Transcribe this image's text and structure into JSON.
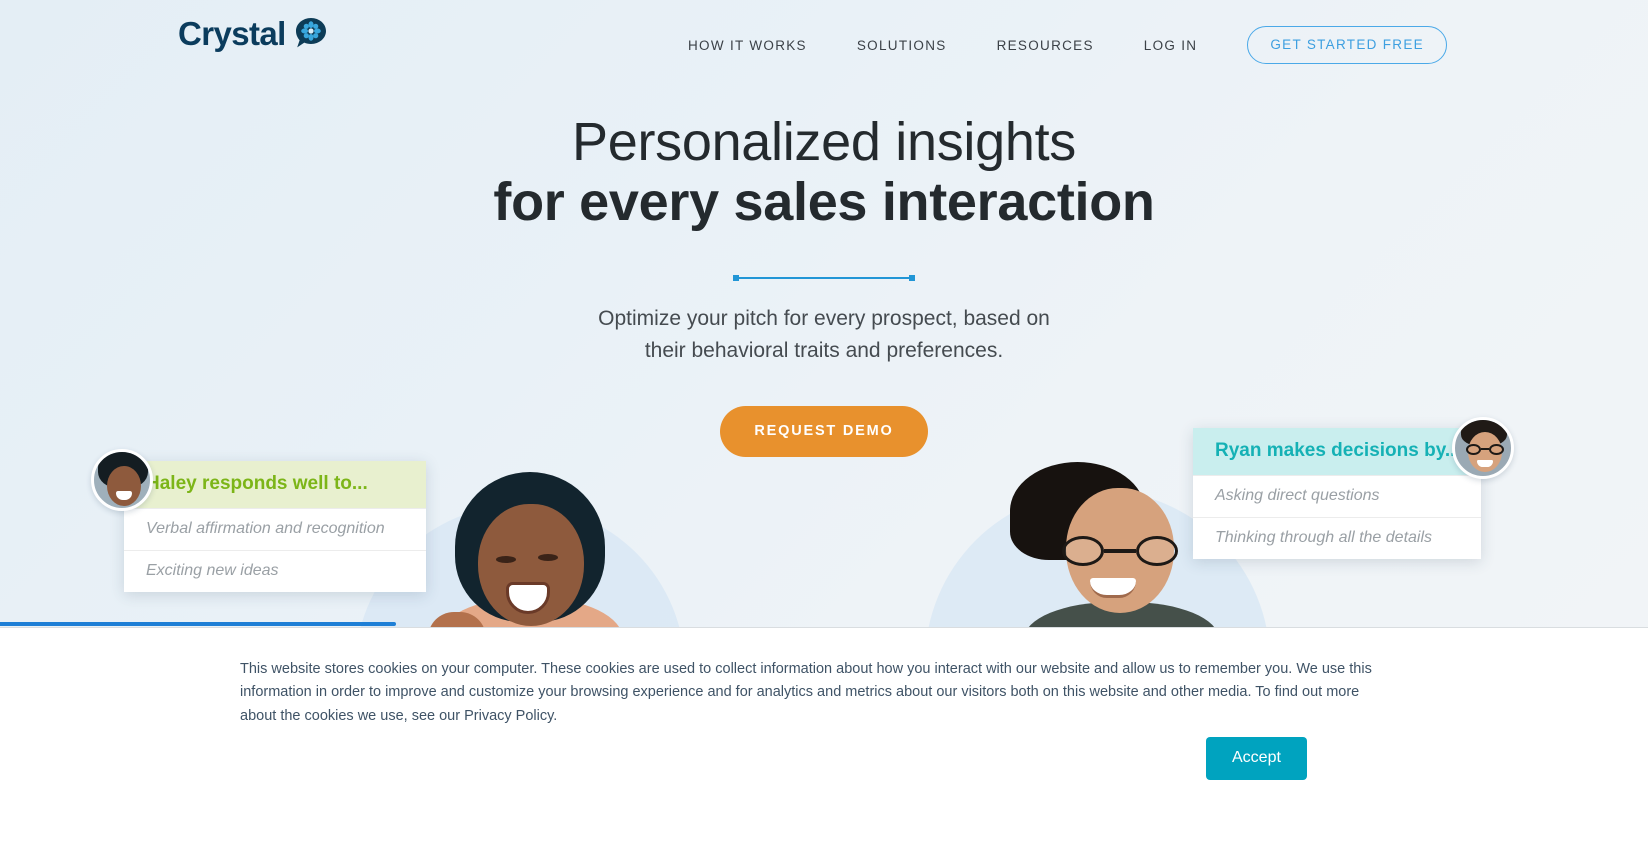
{
  "brand": {
    "name": "Crystal",
    "logo_icon": "crystal-flower-speech-bubble-icon",
    "logo_color": "#0b3c5d",
    "accent_blue": "#2196d6"
  },
  "nav": {
    "items": [
      {
        "label": "HOW IT WORKS"
      },
      {
        "label": "SOLUTIONS"
      },
      {
        "label": "RESOURCES"
      },
      {
        "label": "LOG IN"
      }
    ],
    "cta": {
      "label": "GET STARTED FREE",
      "color": "#3d9fe0"
    }
  },
  "hero": {
    "headline_line1": "Personalized insights",
    "headline_line2": "for every sales interaction",
    "subhead_line1": "Optimize your pitch for every prospect, based on",
    "subhead_line2": "their behavioral traits and preferences.",
    "cta": {
      "label": "REQUEST DEMO",
      "color": "#e8912d"
    }
  },
  "cards": {
    "left": {
      "title": "Haley responds well to...",
      "title_color": "#7cb518",
      "header_bg": "#e8f0cf",
      "avatar": "haley-avatar",
      "rows": [
        "Verbal affirmation and recognition",
        "Exciting new ideas"
      ]
    },
    "right": {
      "title": "Ryan makes decisions by...",
      "title_color": "#15b1b5",
      "header_bg": "#c9eeee",
      "avatar": "ryan-avatar",
      "rows": [
        "Asking direct questions",
        "Thinking through all the details"
      ]
    }
  },
  "progress": {
    "percent": 24,
    "color": "#1e7fd6"
  },
  "cookie_banner": {
    "text_before_link": "This website stores cookies on your computer. These cookies are used to collect information about how you interact with our website and allow us to remember you. We use this information in order to improve and customize your browsing experience and for analytics and metrics about our visitors both on this website and other media. To find out more about the cookies we use, see our ",
    "link_label": "Privacy Policy",
    "text_after_link": ".",
    "accept_label": "Accept",
    "accept_color": "#00a3bf"
  }
}
